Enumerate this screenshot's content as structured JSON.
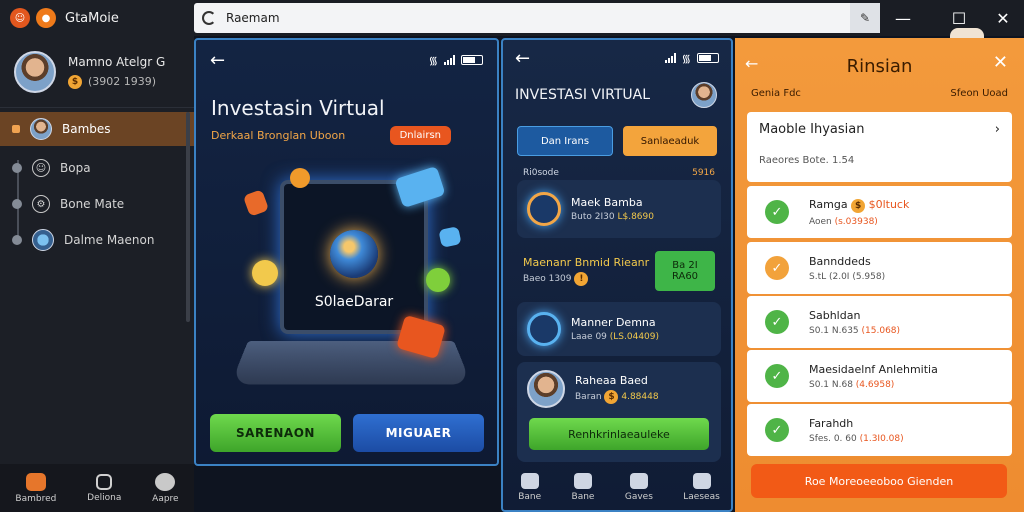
{
  "app": {
    "name": "GtaMoie",
    "profile": {
      "name": "Mamno Atelgr G",
      "sub": "(3902 1939)"
    },
    "nav": [
      {
        "label": "Bambes"
      },
      {
        "label": "Bopa"
      },
      {
        "label": "Bone Mate"
      },
      {
        "label": "Dalme Maenon"
      }
    ],
    "bottom_tabs": [
      "Bambred",
      "Deliona",
      "Aapre"
    ]
  },
  "browser": {
    "url": "Raemam"
  },
  "phone1": {
    "title": "Investasin Virtual",
    "subtitle": "Derkaal Bronglan Uboon",
    "badge": "Dnlairsn",
    "screen_label": "S0laeDarar",
    "buttons": {
      "left": "SARENAON",
      "right": "MIGUAER"
    }
  },
  "phone2": {
    "title": "INVESTASI VIRTUAL",
    "tabs": [
      "Dan Irans",
      "Sanlaeaduk"
    ],
    "section": {
      "left": "Ri0sode",
      "right": "5916"
    },
    "cards": [
      {
        "title": "Maek Bamba",
        "sub": "Buto 2I30 ",
        "amount": "L$.8690"
      },
      {
        "title": "Maenanr Bnmid Rieanr",
        "sub": "Baeo 1309",
        "tag_top": "Ba 2I",
        "tag_bottom": "RA60"
      },
      {
        "title": "Manner Demna",
        "sub": "Laae 09 ",
        "amount": "(LS.04409)"
      },
      {
        "title": "Raheaa Baed",
        "sub": "Baran ",
        "amount": "4.88448"
      }
    ],
    "button": "Renhkrinlaeauleke",
    "bottom_tabs": [
      "Bane",
      "Bane",
      "Gaves",
      "Laeseas"
    ]
  },
  "panel": {
    "title": "Rinsian",
    "sub_left": "Genia Fdc",
    "sub_right": "Sfeon Uoad",
    "main": {
      "title": "Maoble Ihyasian",
      "sub": "Raeores Bote. 1.54"
    },
    "items": [
      {
        "title": "Ramga ",
        "highlight": "$0ltuck",
        "sub": "Aoen ",
        "sub_hl": "(s.03938)",
        "status": "green"
      },
      {
        "title": "Bannddeds",
        "highlight": "",
        "sub": "S.tL (2.0I ",
        "sub_hl": "(5.958)",
        "status": "orange"
      },
      {
        "title": "Sabhldan",
        "highlight": "",
        "sub": "S0.1 N.635 ",
        "sub_hl": "(15.068)",
        "status": "green"
      },
      {
        "title": "Maesidaelnf Anlehmitia",
        "highlight": "",
        "sub": "S0.1 N.68 ",
        "sub_hl": "(4.6958)",
        "status": "green"
      },
      {
        "title": "Farahdh",
        "highlight": "",
        "sub": "Sfes. 0. 60 ",
        "sub_hl": "(1.3I0.08)",
        "status": "green"
      }
    ],
    "button": "Roe Moreoeeoboo Gienden"
  }
}
